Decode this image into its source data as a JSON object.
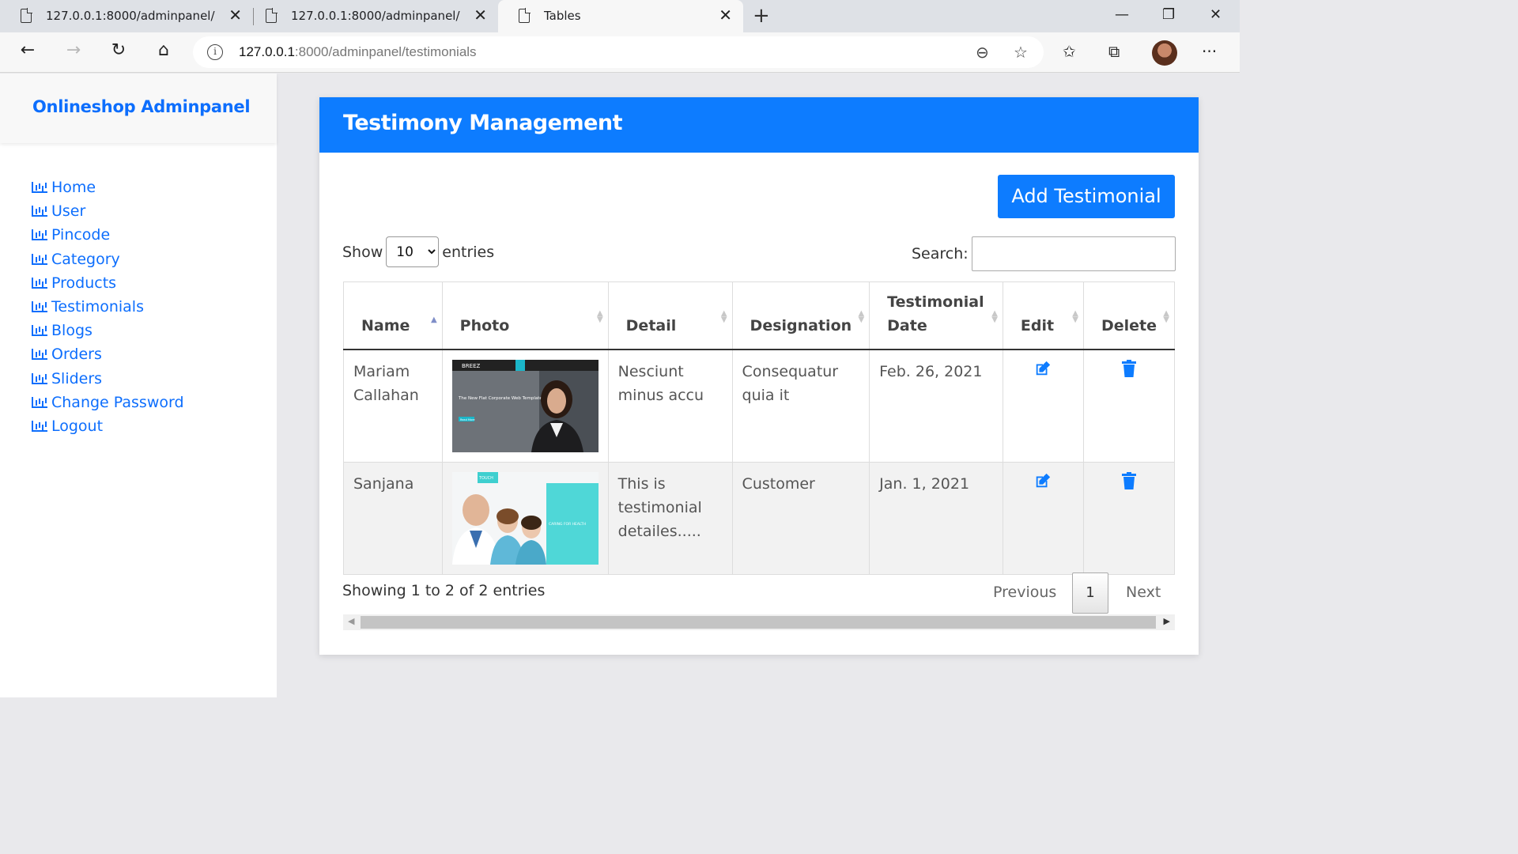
{
  "browser": {
    "tabs": [
      {
        "title": "127.0.0.1:8000/adminpanel/"
      },
      {
        "title": "127.0.0.1:8000/adminpanel/"
      },
      {
        "title": "Tables"
      }
    ],
    "url_host": "127.0.0.1",
    "url_rest": ":8000/adminpanel/testimonials"
  },
  "sidebar": {
    "brand": "Onlineshop Adminpanel",
    "items": [
      {
        "label": "Home"
      },
      {
        "label": "User"
      },
      {
        "label": "Pincode"
      },
      {
        "label": "Category"
      },
      {
        "label": "Products"
      },
      {
        "label": "Testimonials"
      },
      {
        "label": "Blogs"
      },
      {
        "label": "Orders"
      },
      {
        "label": "Sliders"
      },
      {
        "label": "Change Password"
      },
      {
        "label": "Logout"
      }
    ]
  },
  "main": {
    "title": "Testimony Management",
    "add_button": "Add Testimonial",
    "length_prefix": "Show",
    "length_value": "10",
    "length_suffix": "entries",
    "search_label": "Search:",
    "columns": [
      "Name",
      "Photo",
      "Detail",
      "Designation",
      "Testimonial Date",
      "Edit",
      "Delete"
    ],
    "rows": [
      {
        "name": "Mariam Callahan",
        "detail": "Nesciunt minus accu",
        "designation": "Consequatur quia it",
        "date": "Feb. 26, 2021"
      },
      {
        "name": "Sanjana",
        "detail": "This is testimonial detailes.....",
        "designation": "Customer",
        "date": "Jan. 1, 2021"
      }
    ],
    "photo1_text": {
      "brand": "BREEZ",
      "headline": "The New Flat Corporate Web Template",
      "button": "Read More"
    },
    "photo2_text": {
      "brand": "TOUCH",
      "banner": "CARING FOR HEALTH"
    },
    "info": "Showing 1 to 2 of 2 entries",
    "pagination": {
      "previous": "Previous",
      "current": "1",
      "next": "Next"
    }
  },
  "colors": {
    "accent": "#0d7cff",
    "brand": "#0d6efd"
  }
}
